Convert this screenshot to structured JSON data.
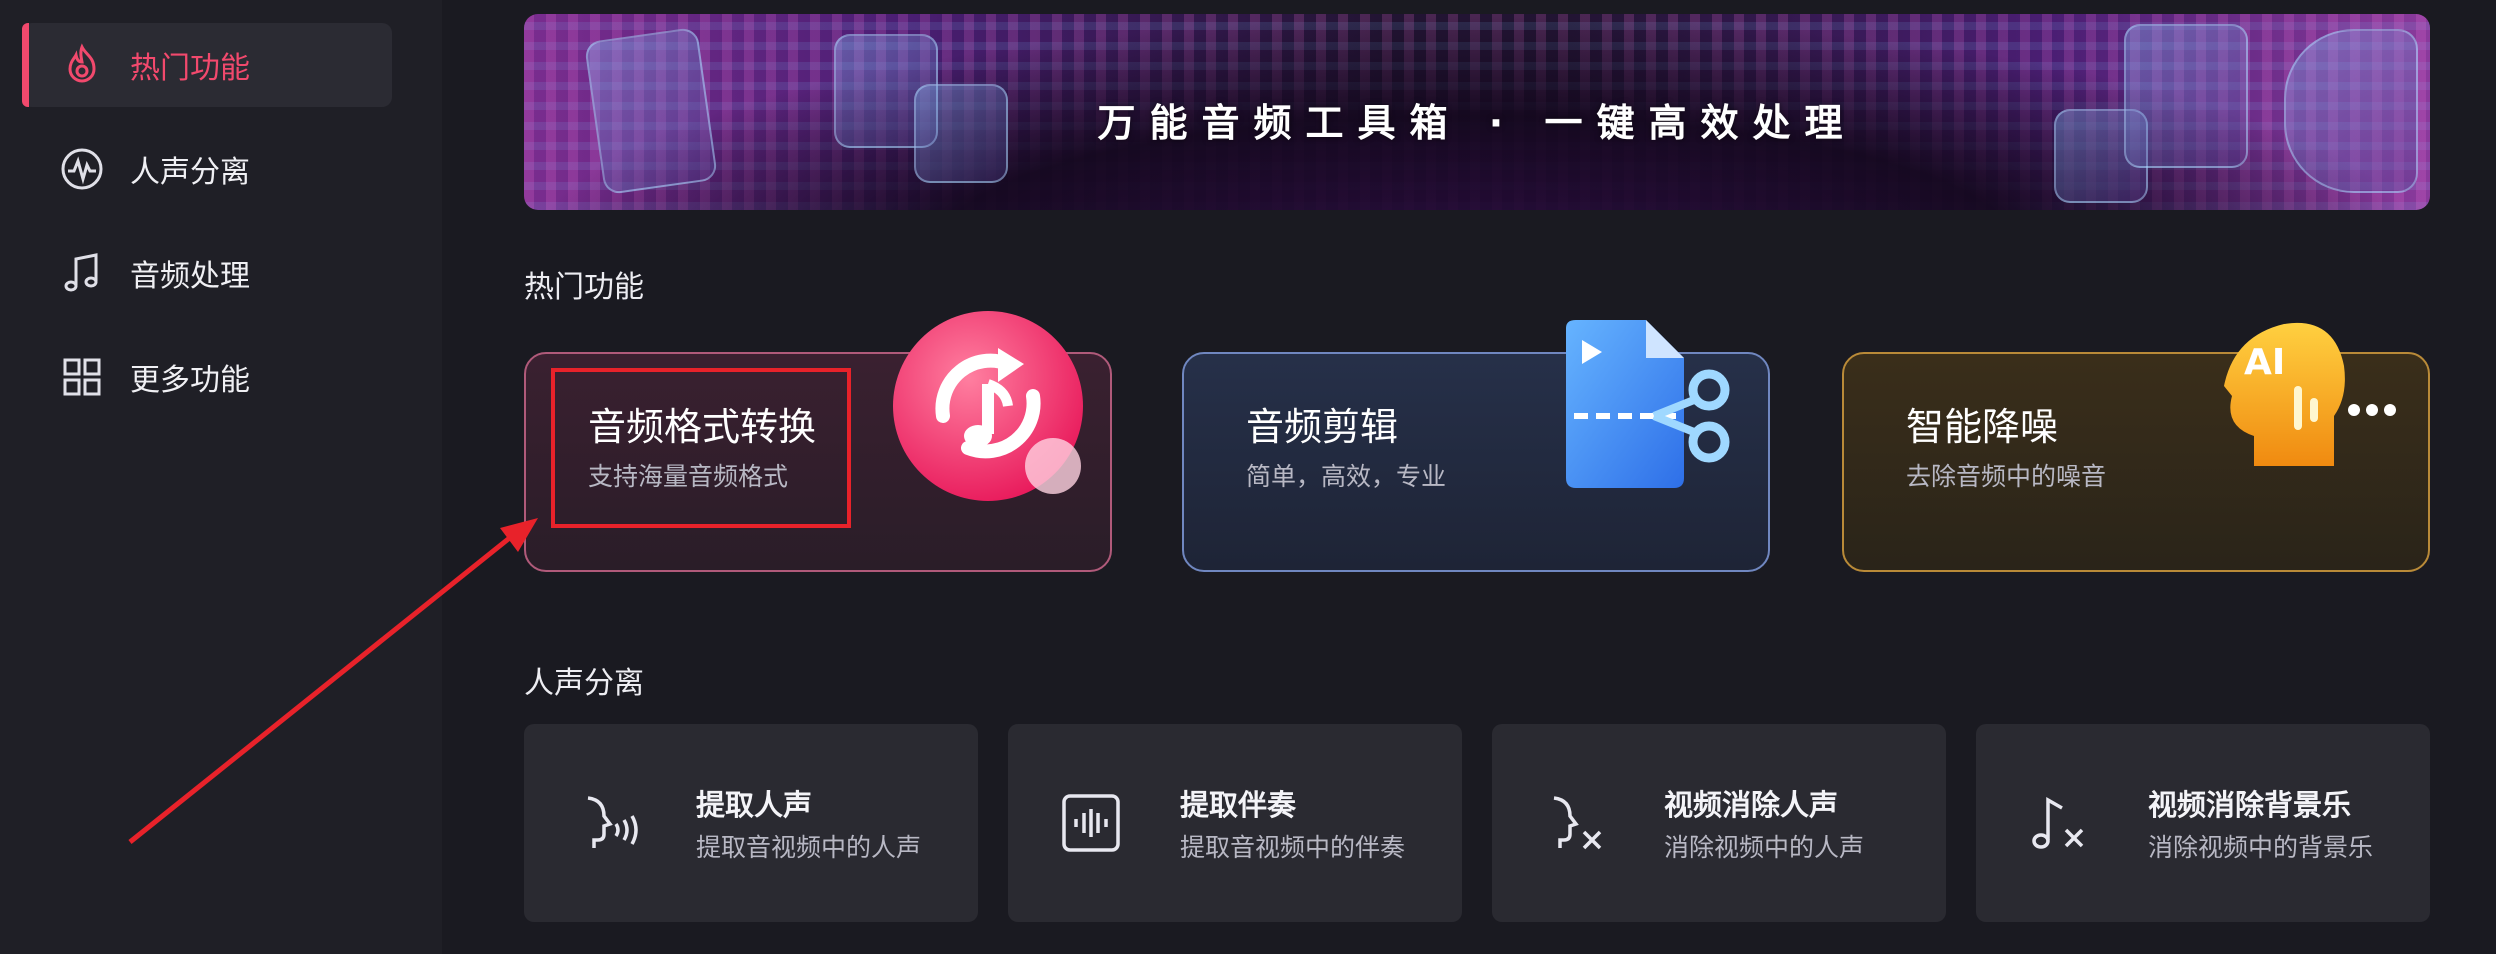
{
  "sidebar": {
    "items": [
      {
        "label": "热门功能",
        "icon": "fire-icon",
        "active": true
      },
      {
        "label": "人声分离",
        "icon": "waveform-icon",
        "active": false
      },
      {
        "label": "音频处理",
        "icon": "music-note-icon",
        "active": false
      },
      {
        "label": "更多功能",
        "icon": "grid-icon",
        "active": false
      }
    ]
  },
  "banner": {
    "text": "万能音频工具箱 · 一键高效处理"
  },
  "hot": {
    "section_title": "热门功能",
    "cards": [
      {
        "title": "音频格式转换",
        "subtitle": "支持海量音频格式",
        "icon": "music-convert-icon",
        "accent": "#f2496d"
      },
      {
        "title": "音频剪辑",
        "subtitle": "简单，高效，专业",
        "icon": "file-scissors-icon",
        "accent": "#4a86f0"
      },
      {
        "title": "智能降噪",
        "subtitle": "去除音频中的噪音",
        "icon": "ai-head-icon",
        "accent": "#f0a020"
      }
    ]
  },
  "vocal": {
    "section_title": "人声分离",
    "cards": [
      {
        "title": "提取人声",
        "subtitle": "提取音视频中的人声",
        "icon": "voice-profile-icon"
      },
      {
        "title": "提取伴奏",
        "subtitle": "提取音视频中的伴奏",
        "icon": "audio-box-icon"
      },
      {
        "title": "视频消除人声",
        "subtitle": "消除视频中的人声",
        "icon": "voice-remove-icon"
      },
      {
        "title": "视频消除背景乐",
        "subtitle": "消除视频中的背景乐",
        "icon": "note-remove-icon"
      }
    ]
  },
  "colors": {
    "accent": "#f2496d",
    "annotation": "#e8222a"
  }
}
